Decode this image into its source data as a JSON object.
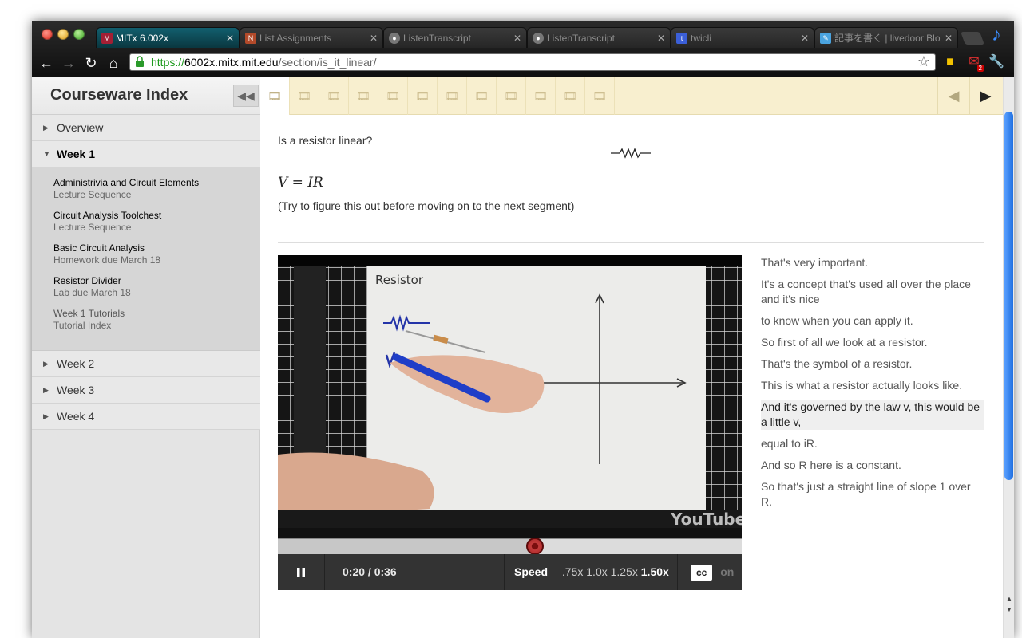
{
  "browser": {
    "tabs": [
      {
        "title": "MITx 6.002x",
        "active": true,
        "favicon": "mitx-icon"
      },
      {
        "title": "List Assignments",
        "active": false,
        "favicon": "nlp-icon"
      },
      {
        "title": "ListenTranscript",
        "active": false,
        "favicon": "globe-icon"
      },
      {
        "title": "ListenTranscript",
        "active": false,
        "favicon": "globe-icon"
      },
      {
        "title": "twicli",
        "active": false,
        "favicon": "twicli-icon"
      },
      {
        "title": "記事を書く | livedoor Blo",
        "active": false,
        "favicon": "livedoor-icon"
      }
    ],
    "url": {
      "scheme": "https://",
      "host": "6002x.mitx.mit.edu",
      "path": "/section/is_it_linear/"
    },
    "mail_count": "2"
  },
  "sidebar": {
    "title": "Courseware Index",
    "weeks": [
      {
        "label": "Overview",
        "expanded": false
      },
      {
        "label": "Week 1",
        "expanded": true
      },
      {
        "label": "Week 2",
        "expanded": false
      },
      {
        "label": "Week 3",
        "expanded": false
      },
      {
        "label": "Week 4",
        "expanded": false
      }
    ],
    "items": [
      {
        "title": "Administrivia and Circuit Elements",
        "subtitle": "Lecture Sequence"
      },
      {
        "title": "Circuit Analysis Toolchest",
        "subtitle": "Lecture Sequence"
      },
      {
        "title": "Basic Circuit Analysis",
        "subtitle": "Homework due March 18"
      },
      {
        "title": "Resistor Divider",
        "subtitle": "Lab due March 18"
      },
      {
        "title": "Week 1 Tutorials",
        "subtitle": "Tutorial Index"
      }
    ]
  },
  "sequence": {
    "count": 12,
    "active_index": 0
  },
  "content": {
    "question": "Is a resistor linear?",
    "equation": "V = IR",
    "hint": "(Try to figure this out before moving on to the next segment)"
  },
  "video": {
    "time": "0:20 / 0:36",
    "progress": 0.555,
    "speed_label": "Speed",
    "speeds": [
      ".75x",
      "1.0x",
      "1.25x",
      "1.50x"
    ],
    "selected_speed": "1.50x",
    "cc_label": "cc",
    "cc_state": "on",
    "whiteboard_title": "Resistor",
    "brand": "YouTube"
  },
  "transcript": [
    {
      "text": "That's very important.",
      "highlighted": false
    },
    {
      "text": "It's a concept that's used all over the place and it's nice",
      "highlighted": false
    },
    {
      "text": "to know when you can apply it.",
      "highlighted": false
    },
    {
      "text": "So first of all we look at a resistor.",
      "highlighted": false
    },
    {
      "text": "That's the symbol of a resistor.",
      "highlighted": false
    },
    {
      "text": "This is what a resistor actually looks like.",
      "highlighted": false
    },
    {
      "text": "And it's governed by the law v, this would be a little v,",
      "highlighted": true
    },
    {
      "text": "equal to iR.",
      "highlighted": false
    },
    {
      "text": "And so R here is a constant.",
      "highlighted": false
    },
    {
      "text": "So that's just a straight line of slope 1 over R.",
      "highlighted": false
    }
  ]
}
